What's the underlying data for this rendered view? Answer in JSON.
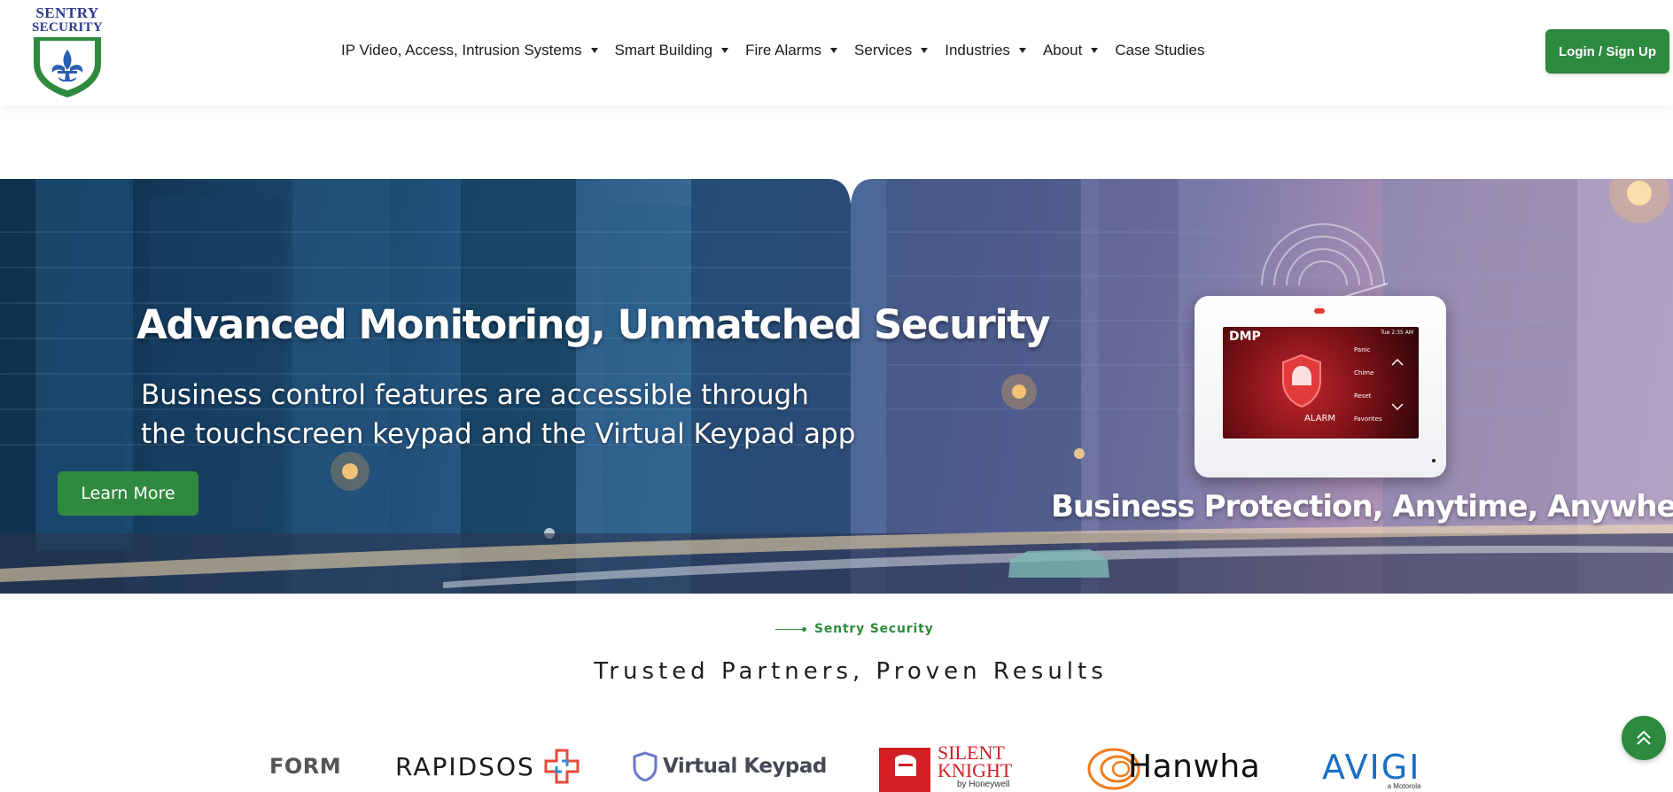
{
  "brand": {
    "name_line1": "SENTRY",
    "name_line2": "SECURITY",
    "logo_icon": "fleur-de-lis-shield"
  },
  "nav": {
    "items": [
      {
        "label": "IP Video, Access, Intrusion Systems",
        "has_dropdown": true
      },
      {
        "label": "Smart Building",
        "has_dropdown": true
      },
      {
        "label": "Fire Alarms",
        "has_dropdown": true
      },
      {
        "label": "Services",
        "has_dropdown": true
      },
      {
        "label": "Industries",
        "has_dropdown": true
      },
      {
        "label": "About",
        "has_dropdown": true
      },
      {
        "label": "Case Studies",
        "has_dropdown": false
      }
    ],
    "login_label": "Login / Sign Up"
  },
  "hero": {
    "title": "Advanced Monitoring, Unmatched Security",
    "subtitle_line1": "Business control features are accessible through",
    "subtitle_line2": "the touchscreen keypad and the Virtual Keypad app",
    "cta_label": "Learn More",
    "tagline": "Business Protection, Anytime, Anywhere",
    "device": {
      "brand": "DMP",
      "time": "Tue 2:35 AM",
      "status": "ALARM",
      "options": [
        "Panic",
        "Chime",
        "Reset",
        "Favorites"
      ]
    }
  },
  "partners": {
    "kicker": "Sentry Security",
    "title": "Trusted Partners, Proven Results",
    "logos": {
      "form": "FORM",
      "rapidsos": "RAPIDSOS",
      "virtual_keypad": "Virtual Keypad",
      "silent_knight_line1": "SILENT",
      "silent_knight_line2": "KNIGHT",
      "silent_knight_sub": "by Honeywell",
      "hanwha": "Hanwha",
      "avigi": "AVIGI",
      "avigi_sub": "a Motorola"
    }
  },
  "colors": {
    "accent_green": "#2b8a3e",
    "logo_blue": "#2b3a8f",
    "rapidsos_red": "#e64a3c",
    "rapidsos_blue": "#2c8fd6",
    "silent_knight_red": "#d21f26",
    "avigi_blue": "#1a6fc4",
    "hanwha_orange": "#f07c1b"
  },
  "icons": {
    "nav_dropdown": "caret-down-icon",
    "scroll_top": "chevron-double-up-icon"
  }
}
